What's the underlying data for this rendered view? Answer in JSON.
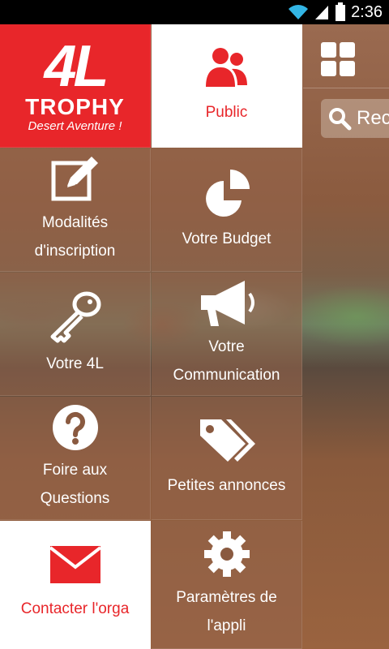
{
  "status_bar": {
    "time": "2:36"
  },
  "brand": {
    "big": "4L",
    "name": "TROPHY",
    "tagline": "Desert Aventure !"
  },
  "tiles": {
    "public": "Public",
    "modalites": [
      "Modalités",
      "d'inscription"
    ],
    "budget": "Votre Budget",
    "votre4l": "Votre 4L",
    "communication": [
      "Votre",
      "Communication"
    ],
    "faq": [
      "Foire aux",
      "Questions"
    ],
    "annonces": "Petites annonces",
    "contact": "Contacter l'orga",
    "parametres": [
      "Paramètres de",
      "l'appli"
    ]
  },
  "search": {
    "text": "Rec"
  },
  "colors": {
    "accent": "#e8262a",
    "tile_white": "#ffffff"
  },
  "icons": [
    "wifi-icon",
    "signal-icon",
    "battery-icon",
    "grid-icon",
    "search-icon",
    "users-icon",
    "edit-icon",
    "pie-chart-icon",
    "key-icon",
    "megaphone-icon",
    "question-icon",
    "tags-icon",
    "mail-icon",
    "gear-icon"
  ]
}
